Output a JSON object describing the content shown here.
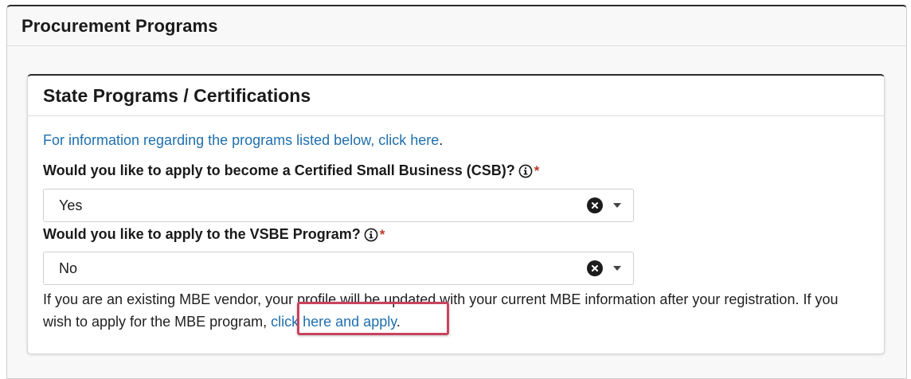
{
  "outer_panel": {
    "title": "Procurement Programs"
  },
  "inner_card": {
    "title": "State Programs / Certifications",
    "info_link_text": "For information regarding the programs listed below, click here",
    "info_suffix": "."
  },
  "csb_field": {
    "label": "Would you like to apply to become a Certified Small Business (CSB)?",
    "required_mark": "*",
    "value": "Yes",
    "icons": [
      "info-icon",
      "clear-icon",
      "chevron-down-icon"
    ]
  },
  "vsbe_field": {
    "label": "Would you like to apply to the VSBE Program?",
    "required_mark": "*",
    "value": "No",
    "icons": [
      "info-icon",
      "clear-icon",
      "chevron-down-icon"
    ]
  },
  "mbe_notice": {
    "text": "If you are an existing MBE vendor, your profile will be updated with your current MBE information after your registration. If you wish to apply for the MBE program, ",
    "link_text": "click here and apply",
    "suffix": "."
  },
  "colors": {
    "link": "#1f6fae",
    "required": "#c0392b",
    "highlight": "#c8435f"
  }
}
